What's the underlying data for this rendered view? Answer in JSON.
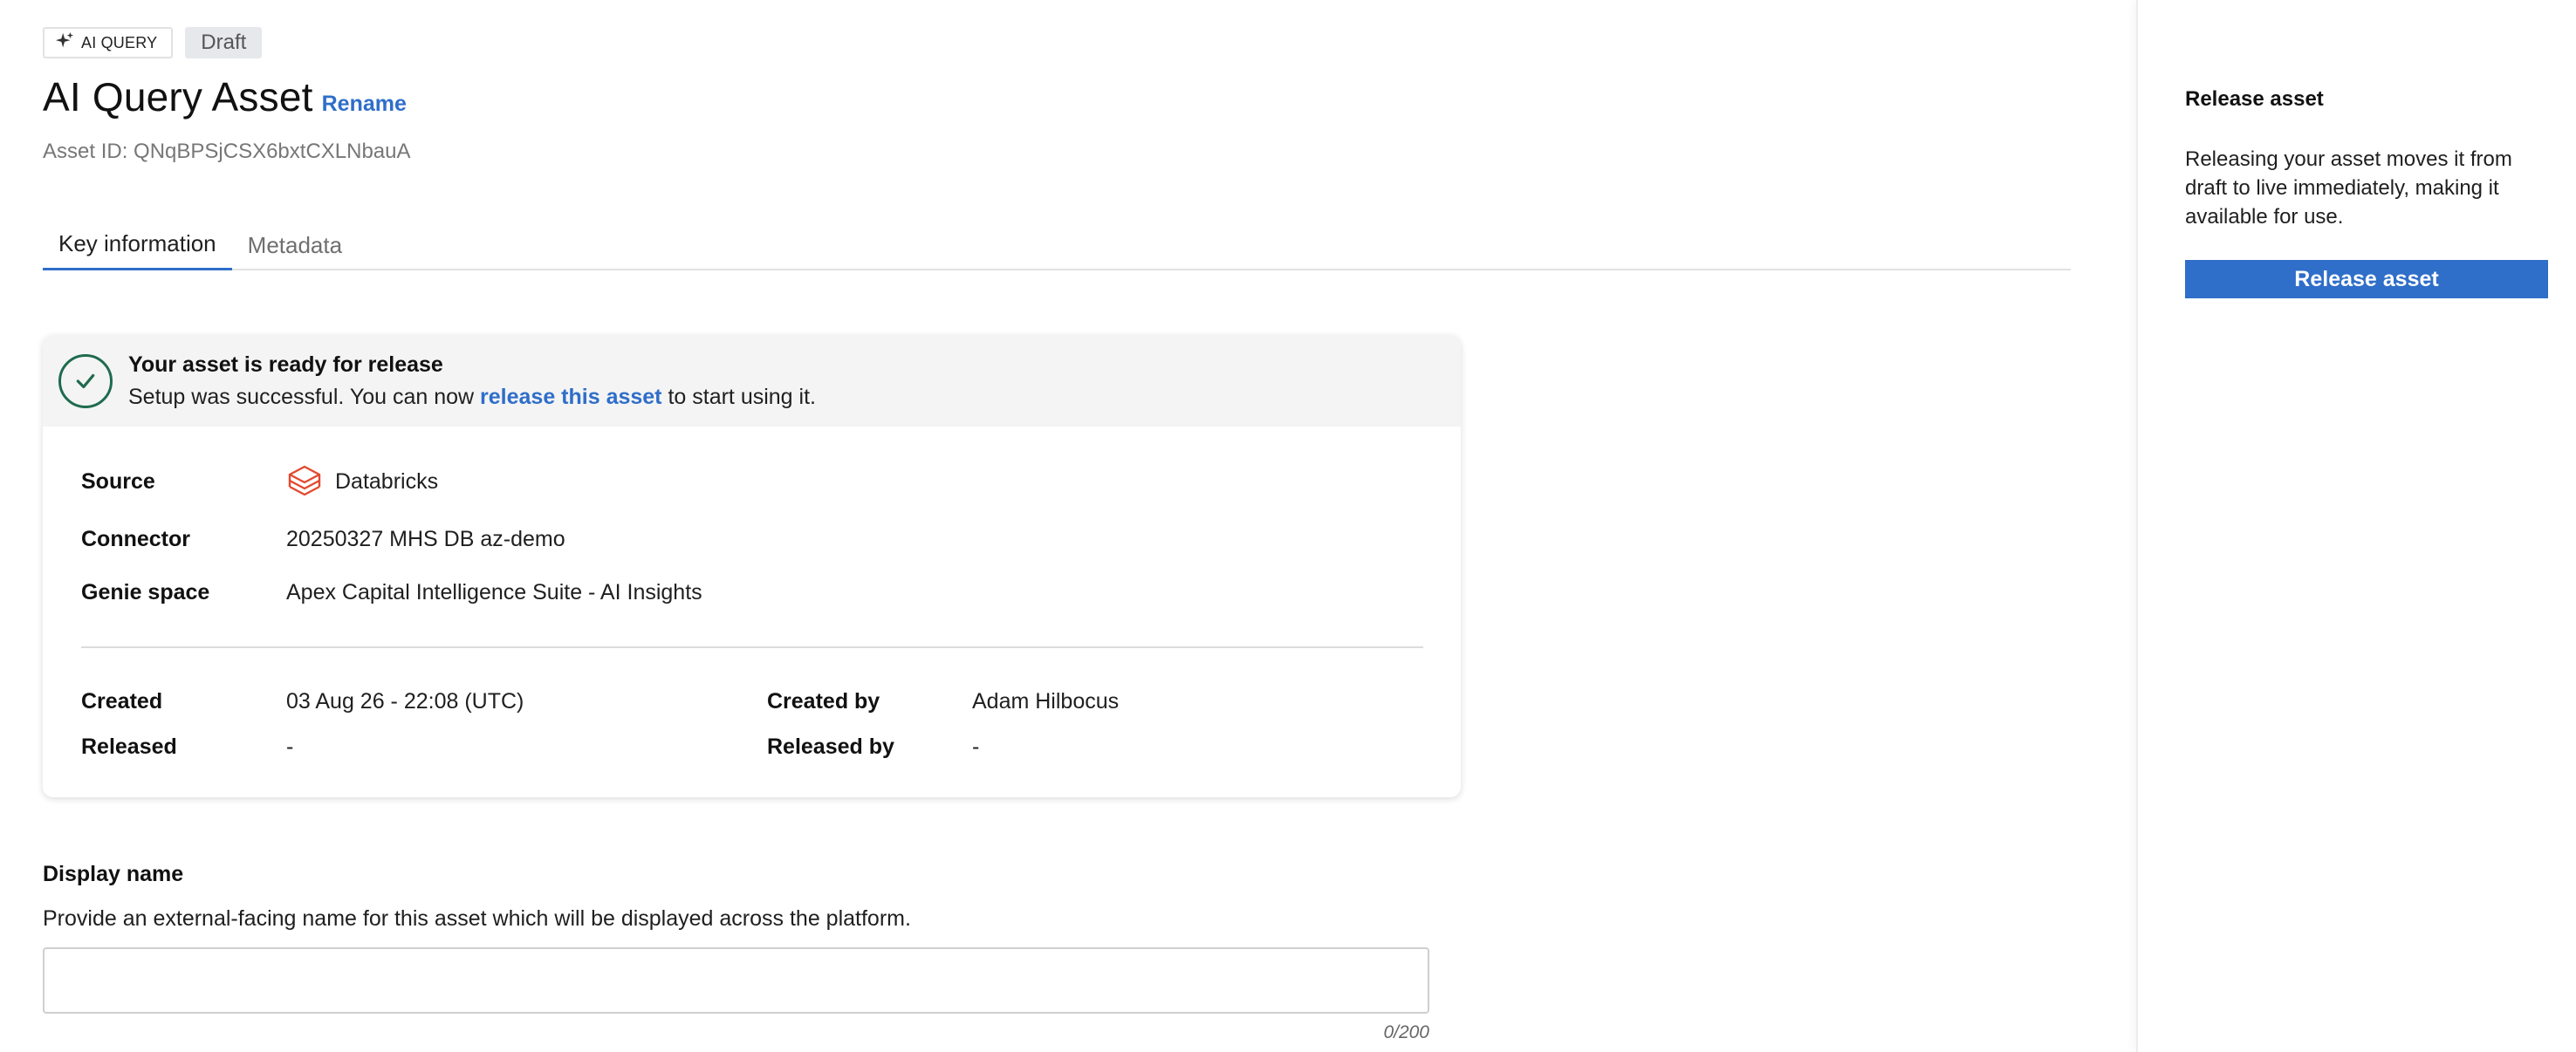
{
  "header": {
    "type_badge": "AI QUERY",
    "status_badge": "Draft",
    "title": "AI Query Asset",
    "rename_label": "Rename",
    "asset_id": "Asset ID: QNqBPSjCSX6bxtCXLNbauA"
  },
  "tabs": [
    {
      "label": "Key information",
      "active": true
    },
    {
      "label": "Metadata",
      "active": false
    }
  ],
  "status_card": {
    "title": "Your asset is ready for release",
    "desc_prefix": "Setup was successful. You can now ",
    "desc_link": "release this asset",
    "desc_suffix": " to start using it.",
    "icon": "check-icon",
    "accent": "#1f6b4e"
  },
  "details": {
    "source_label": "Source",
    "source_value": "Databricks",
    "source_icon": "databricks-icon",
    "connector_label": "Connector",
    "connector_value": "20250327 MHS DB az-demo",
    "genie_label": "Genie space",
    "genie_value": "Apex Capital Intelligence Suite - AI Insights"
  },
  "meta": {
    "created_label": "Created",
    "created_value": "03 Aug 26 - 22:08 (UTC)",
    "created_by_label": "Created by",
    "created_by_value": "Adam Hilbocus",
    "released_label": "Released",
    "released_value": "-",
    "released_by_label": "Released by",
    "released_by_value": "-"
  },
  "display_name": {
    "title": "Display name",
    "description": "Provide an external-facing name for this asset which will be displayed across the platform.",
    "value": "",
    "counter": "0/200"
  },
  "sidebar": {
    "title": "Release asset",
    "description": "Releasing your asset moves it from draft to live immediately, making it available for use.",
    "button_label": "Release asset"
  },
  "colors": {
    "primary": "#2f6ec9",
    "databricks": "#e2492f"
  }
}
